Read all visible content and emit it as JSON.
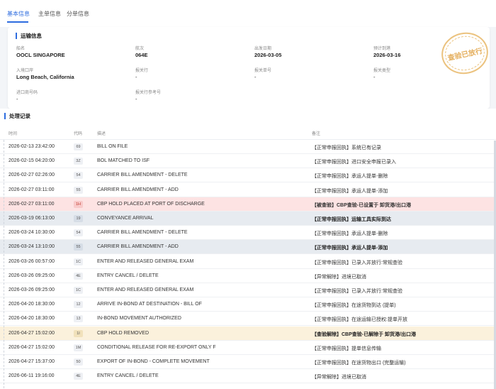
{
  "tabs": [
    {
      "label": "基本信息",
      "active": true
    },
    {
      "label": "主单信息",
      "active": false
    },
    {
      "label": "分单信息",
      "active": false
    }
  ],
  "stamp": {
    "text": "查验已放行"
  },
  "transport": {
    "title": "运输信息",
    "fields": [
      {
        "label": "船名",
        "value": "OOCL SINGAPORE",
        "bold": true
      },
      {
        "label": "航次",
        "value": "064E",
        "bold": true
      },
      {
        "label": "出发日期",
        "value": "2026-03-05",
        "bold": true
      },
      {
        "label": "预计到港",
        "value": "2026-03-16",
        "bold": true
      },
      {
        "label": "入境口岸",
        "value": "Long Beach, California",
        "bold": true
      },
      {
        "label": "报关行",
        "value": "-",
        "bold": false
      },
      {
        "label": "报关单号",
        "value": "-",
        "bold": false
      },
      {
        "label": "报关类型",
        "value": "-",
        "bold": false
      },
      {
        "label": "进口商号码",
        "value": "-",
        "bold": false
      },
      {
        "label": "报关行参考号",
        "value": "-",
        "bold": false
      }
    ]
  },
  "records": {
    "title": "处理记录",
    "columns": {
      "time": "时间",
      "code": "代码",
      "desc": "描述",
      "remark": "备注"
    },
    "rows": [
      {
        "time": "2026-02-13 23:42:00",
        "code": "69",
        "desc": "BILL ON FILE",
        "remark": "【正常申报回执】系统已有记录",
        "style": ""
      },
      {
        "time": "2026-02-15 04:20:00",
        "code": "3Z",
        "desc": "BOL MATCHED TO ISF",
        "remark": "【正常申报回执】进口安全申报已录入",
        "style": ""
      },
      {
        "time": "2026-02-27 02:26:00",
        "code": "54",
        "desc": "CARRIER BILL AMENDMENT - DELETE",
        "remark": "【正常申报回执】承运人提单-删除",
        "style": ""
      },
      {
        "time": "2026-02-27 03:11:00",
        "code": "55",
        "desc": "CARRIER BILL AMENDMENT - ADD",
        "remark": "【正常申报回执】承运人提单-添加",
        "style": ""
      },
      {
        "time": "2026-02-27 03:11:00",
        "code": "1H",
        "desc": "CBP HOLD PLACED AT PORT OF DISCHARGE",
        "remark": "【被查验】CBP查验-已设置于 卸货港/出口港",
        "style": "red"
      },
      {
        "time": "2026-03-19 06:13:00",
        "code": "19",
        "desc": "CONVEYANCE ARRIVAL",
        "remark": "【正常申报回执】运输工具实际到达",
        "style": "gray"
      },
      {
        "time": "2026-03-24 10:30:00",
        "code": "54",
        "desc": "CARRIER BILL AMENDMENT - DELETE",
        "remark": "【正常申报回执】承运人提单-删除",
        "style": ""
      },
      {
        "time": "2026-03-24 13:10:00",
        "code": "55",
        "desc": "CARRIER BILL AMENDMENT - ADD",
        "remark": "【正常申报回执】承运人提单-添加",
        "style": "gray"
      },
      {
        "time": "2026-03-26 00:57:00",
        "code": "1C",
        "desc": "ENTER AND RELEASED GENERAL EXAM",
        "remark": "【正常申报回执】已录入并放行:常规查验",
        "style": ""
      },
      {
        "time": "2026-03-26 09:25:00",
        "code": "4E",
        "desc": "ENTRY CANCEL / DELETE",
        "remark": "【异常解除】进境已取消",
        "style": ""
      },
      {
        "time": "2026-03-26 09:25:00",
        "code": "1C",
        "desc": "ENTER AND RELEASED GENERAL EXAM",
        "remark": "【正常申报回执】已录入并放行:常规查验",
        "style": ""
      },
      {
        "time": "2026-04-20 18:30:00",
        "code": "12",
        "desc": "ARRIVE IN-BOND AT DESTINATION - BILL OF",
        "remark": "【正常申报回执】在途货物到达 (提单)",
        "style": ""
      },
      {
        "time": "2026-04-20 18:30:00",
        "code": "13",
        "desc": "IN-BOND MOVEMENT AUTHORIZED",
        "remark": "【正常申报回执】在途运输已授权:提单开放",
        "style": ""
      },
      {
        "time": "2026-04-27 15:02:00",
        "code": "1I",
        "desc": "CBP HOLD REMOVED",
        "remark": "【查验解除】CBP查验-已解除于 卸货港/出口港",
        "style": "yellow"
      },
      {
        "time": "2026-04-27 15:02:00",
        "code": "1M",
        "desc": "CONDITIONAL RELEASE FOR RE-EXPORT ONLY F",
        "remark": "【正常申报回执】提单信息传输",
        "style": ""
      },
      {
        "time": "2026-04-27 15:37:00",
        "code": "50",
        "desc": "EXPORT OF IN-BOND - COMPLETE MOVEMENT",
        "remark": "【正常申报回执】在途货物出口 (完整运输)",
        "style": ""
      },
      {
        "time": "2026-06-11 19:16:00",
        "code": "4E",
        "desc": "ENTRY CANCEL / DELETE",
        "remark": "【异常解除】进境已取消",
        "style": ""
      }
    ]
  }
}
